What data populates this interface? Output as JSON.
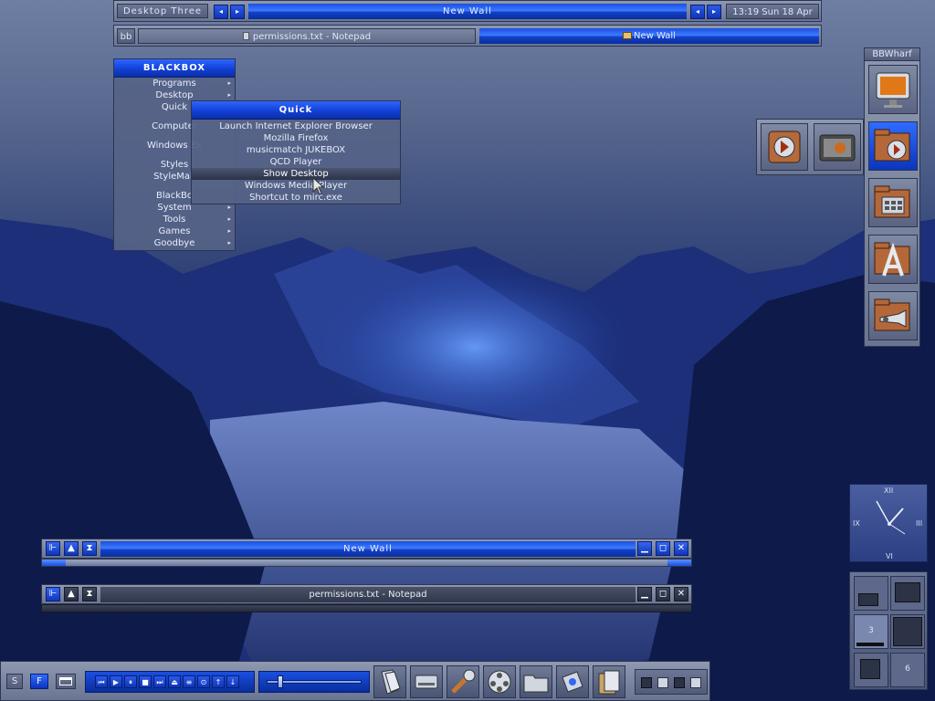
{
  "toolbar": {
    "workspace": "Desktop Three",
    "window_label": "New Wall",
    "clock": "13:19 Sun 18 Apr"
  },
  "taskbar": {
    "bb_label": "bb",
    "items": [
      {
        "label": "permissions.txt - Notepad",
        "active": false
      },
      {
        "label": "New Wall",
        "active": true
      }
    ]
  },
  "root_menu": {
    "title": "BLACKBOX",
    "items": [
      "Programs",
      "Desktop",
      "Quick",
      "Computer",
      "Windows Ex",
      "Styles",
      "StyleMak",
      "BlackBo",
      "System",
      "Tools",
      "Games",
      "Goodbye"
    ]
  },
  "quick_menu": {
    "title": "Quick",
    "items": [
      "Launch Internet Explorer Browser",
      "Mozilla Firefox",
      "musicmatch JUKEBOX",
      "QCD Player",
      "Show Desktop",
      "Windows Media Player",
      "Shortcut to mirc.exe"
    ],
    "highlighted": "Show Desktop"
  },
  "wharf": {
    "title": "BBWharf"
  },
  "windows": [
    {
      "title": "New Wall",
      "style": "active"
    },
    {
      "title": "permissions.txt - Notepad",
      "style": "inactive"
    }
  ],
  "clock_widget": {
    "numerals": [
      "XII",
      "III",
      "VI",
      "IX"
    ],
    "time": "13:19"
  },
  "pager": {
    "labels": [
      "3",
      "6"
    ]
  },
  "bottom_bar": {
    "left_buttons": [
      "S",
      "F"
    ]
  },
  "colors": {
    "accent_blue": "#1a4fe0",
    "panel_grey": "#7a849f",
    "desktop_dark": "#0f1f55"
  }
}
